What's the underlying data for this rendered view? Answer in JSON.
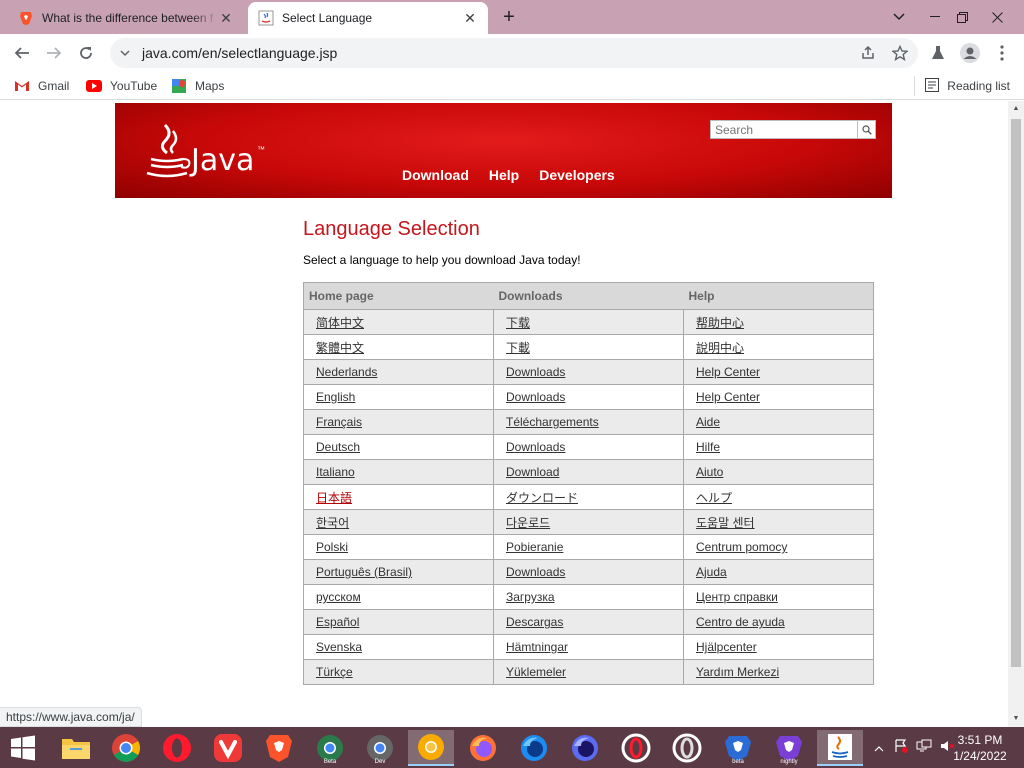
{
  "browser": {
    "tabs": [
      {
        "title": "What is the difference between f",
        "active": false
      },
      {
        "title": "Select Language",
        "active": true
      }
    ],
    "address": "java.com/en/selectlanguage.jsp",
    "bookmarks": [
      "Gmail",
      "YouTube",
      "Maps"
    ],
    "reading_list": "Reading list",
    "status_url": "https://www.java.com/ja/"
  },
  "header": {
    "logo_text": "Java",
    "logo_tm": "™",
    "nav": [
      "Download",
      "Help",
      "Developers"
    ],
    "search_placeholder": "Search"
  },
  "page": {
    "title": "Language Selection",
    "subtitle": "Select a language to help you download Java today!",
    "columns": [
      "Home page",
      "Downloads",
      "Help"
    ],
    "rows": [
      [
        "简体中文",
        "下载",
        "帮助中心"
      ],
      [
        "繁體中文",
        "下載",
        "說明中心"
      ],
      [
        "Nederlands",
        "Downloads",
        "Help Center"
      ],
      [
        "English",
        "Downloads",
        "Help Center"
      ],
      [
        "Français",
        "Téléchargements",
        "Aide"
      ],
      [
        "Deutsch",
        "Downloads",
        "Hilfe"
      ],
      [
        "Italiano",
        "Download",
        "Aiuto"
      ],
      [
        "日本語",
        "ダウンロード",
        "ヘルプ"
      ],
      [
        "한국어",
        "다운로드",
        "도움말 센터"
      ],
      [
        "Polski",
        "Pobieranie",
        "Centrum pomocy"
      ],
      [
        "Português (Brasil)",
        "Downloads",
        "Ajuda"
      ],
      [
        "русском",
        "Загрузка",
        "Центр справки"
      ],
      [
        "Español",
        "Descargas",
        "Centro de ayuda"
      ],
      [
        "Svenska",
        "Hämtningar",
        "Hjälpcenter"
      ],
      [
        "Türkçe",
        "Yüklemeler",
        "Yardım Merkezi"
      ]
    ],
    "visited_row": 7
  },
  "taskbar": {
    "apps": [
      "windows-start",
      "file-explorer",
      "chrome",
      "opera",
      "vivaldi",
      "brave",
      "chrome-beta",
      "chrome-dev",
      "chrome-canary",
      "firefox",
      "firefox-developer",
      "firefox-nightly",
      "opera-gx",
      "opera-browser",
      "brave-beta",
      "brave-nightly",
      "java"
    ],
    "app_labels": {
      "chrome-beta": "Beta",
      "chrome-dev": "Dev",
      "brave-beta": "beta",
      "brave-nightly": "nightly"
    },
    "time": "3:51 PM",
    "date": "1/24/2022"
  },
  "colors": {
    "java_red": "#c4161c",
    "tab_strip": "#c8a2b2",
    "taskbar": "#5a3a44",
    "visited_link": "#b30000"
  }
}
